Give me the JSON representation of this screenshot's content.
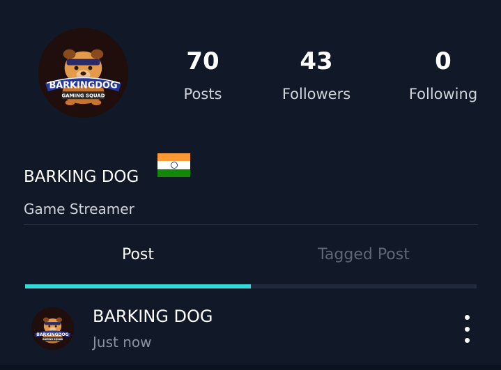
{
  "profile": {
    "name": "BARKING DOG",
    "bio": "Game Streamer",
    "flag_icon": "india-flag-icon",
    "avatar": {
      "icon": "barking-dog-logo-icon",
      "logo_text": "BARKINGDOG",
      "logo_subtext": "GAMING SQUAD"
    }
  },
  "stats": {
    "posts": {
      "value": "70",
      "label": "Posts"
    },
    "followers": {
      "value": "43",
      "label": "Followers"
    },
    "following": {
      "value": "0",
      "label": "Following"
    }
  },
  "tabs": [
    {
      "label": "Post",
      "active": true
    },
    {
      "label": "Tagged Post",
      "active": false
    }
  ],
  "post": {
    "author": "BARKING DOG",
    "time": "Just now",
    "more_icon": "more-vertical-icon"
  },
  "colors": {
    "background": "#111827",
    "accent": "#34d8d6",
    "inactive_tab": "#5f6776",
    "muted_text": "#8b929d"
  }
}
